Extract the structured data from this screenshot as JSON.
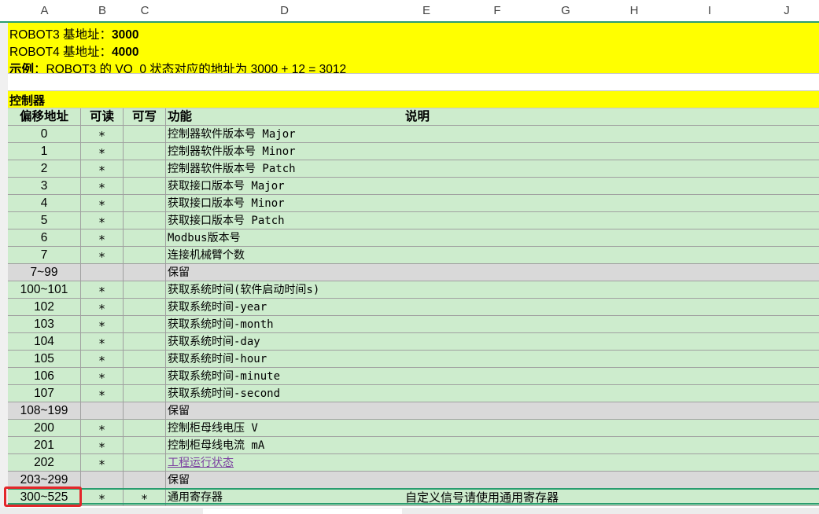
{
  "columns": [
    "A",
    "B",
    "C",
    "D",
    "E",
    "F",
    "G",
    "H",
    "I",
    "J"
  ],
  "notes": {
    "robot3_label": "ROBOT3 基地址：",
    "robot3_value": "3000",
    "robot4_label": "ROBOT4 基地址：",
    "robot4_value": "4000",
    "example_label": "示例",
    "example_text": "：ROBOT3 的 VO_0 状态对应的地址为 3000 + 12 = 3012"
  },
  "section_title": "控制器",
  "table_header": {
    "offset": "偏移地址",
    "readable": "可读",
    "writable": "可写",
    "function": "功能",
    "description": "说明"
  },
  "rows": [
    {
      "offset": "0",
      "r": "*",
      "w": "",
      "func": "控制器软件版本号 Major",
      "desc": "",
      "shade": "green"
    },
    {
      "offset": "1",
      "r": "*",
      "w": "",
      "func": "控制器软件版本号 Minor",
      "desc": "",
      "shade": "green"
    },
    {
      "offset": "2",
      "r": "*",
      "w": "",
      "func": "控制器软件版本号 Patch",
      "desc": "",
      "shade": "green"
    },
    {
      "offset": "3",
      "r": "*",
      "w": "",
      "func": "获取接口版本号 Major",
      "desc": "",
      "shade": "green"
    },
    {
      "offset": "4",
      "r": "*",
      "w": "",
      "func": "获取接口版本号 Minor",
      "desc": "",
      "shade": "green"
    },
    {
      "offset": "5",
      "r": "*",
      "w": "",
      "func": "获取接口版本号 Patch",
      "desc": "",
      "shade": "green"
    },
    {
      "offset": "6",
      "r": "*",
      "w": "",
      "func": "Modbus版本号",
      "desc": "",
      "shade": "green"
    },
    {
      "offset": "7",
      "r": "*",
      "w": "",
      "func": "连接机械臂个数",
      "desc": "",
      "shade": "green"
    },
    {
      "offset": "7~99",
      "r": "",
      "w": "",
      "func": "保留",
      "desc": "",
      "shade": "gray"
    },
    {
      "offset": "100~101",
      "r": "*",
      "w": "",
      "func": "获取系统时间(软件启动时间s)",
      "desc": "",
      "shade": "green"
    },
    {
      "offset": "102",
      "r": "*",
      "w": "",
      "func": "获取系统时间-year",
      "desc": "",
      "shade": "green"
    },
    {
      "offset": "103",
      "r": "*",
      "w": "",
      "func": "获取系统时间-month",
      "desc": "",
      "shade": "green"
    },
    {
      "offset": "104",
      "r": "*",
      "w": "",
      "func": "获取系统时间-day",
      "desc": "",
      "shade": "green"
    },
    {
      "offset": "105",
      "r": "*",
      "w": "",
      "func": "获取系统时间-hour",
      "desc": "",
      "shade": "green"
    },
    {
      "offset": "106",
      "r": "*",
      "w": "",
      "func": "获取系统时间-minute",
      "desc": "",
      "shade": "green"
    },
    {
      "offset": "107",
      "r": "*",
      "w": "",
      "func": "获取系统时间-second",
      "desc": "",
      "shade": "green"
    },
    {
      "offset": "108~199",
      "r": "",
      "w": "",
      "func": "保留",
      "desc": "",
      "shade": "gray"
    },
    {
      "offset": "200",
      "r": "*",
      "w": "",
      "func": "控制柜母线电压 V",
      "desc": "",
      "shade": "green"
    },
    {
      "offset": "201",
      "r": "*",
      "w": "",
      "func": "控制柜母线电流 mA",
      "desc": "",
      "shade": "green"
    },
    {
      "offset": "202",
      "r": "*",
      "w": "",
      "func": "工程运行状态",
      "desc": "",
      "shade": "green",
      "link": true
    },
    {
      "offset": "203~299",
      "r": "",
      "w": "",
      "func": "保留",
      "desc": "",
      "shade": "gray"
    },
    {
      "offset": "300~525",
      "r": "*",
      "w": "*",
      "func": "通用寄存器",
      "desc": "自定义信号请使用通用寄存器",
      "shade": "green"
    }
  ],
  "colors": {
    "yellow_band": "#ffff00",
    "green_row": "#cdeccd",
    "gray_row": "#d9d9d9",
    "selection_border": "#e3262a",
    "link": "#7b3fa0"
  }
}
